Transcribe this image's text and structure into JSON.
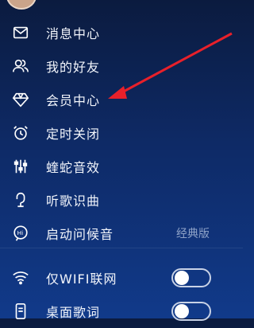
{
  "menu": {
    "items": [
      {
        "label": "消息中心",
        "icon": "mail-icon"
      },
      {
        "label": "我的好友",
        "icon": "friends-icon"
      },
      {
        "label": "会员中心",
        "icon": "diamond-icon"
      },
      {
        "label": "定时关闭",
        "icon": "alarm-clock-icon"
      },
      {
        "label": "蝰蛇音效",
        "icon": "equalizer-icon"
      },
      {
        "label": "听歌识曲",
        "icon": "microphone-icon"
      },
      {
        "label": "启动问候音",
        "icon": "hi-bubble-icon",
        "extra": "经典版"
      }
    ],
    "settings": [
      {
        "label": "仅WIFI联网",
        "icon": "wifi-icon",
        "on": false
      },
      {
        "label": "桌面歌词",
        "icon": "phone-lyrics-icon",
        "on": false
      }
    ]
  },
  "colors": {
    "accent_arrow": "#e8202a",
    "background_top": "#0b1b3f",
    "background_bottom": "#113a8a"
  }
}
